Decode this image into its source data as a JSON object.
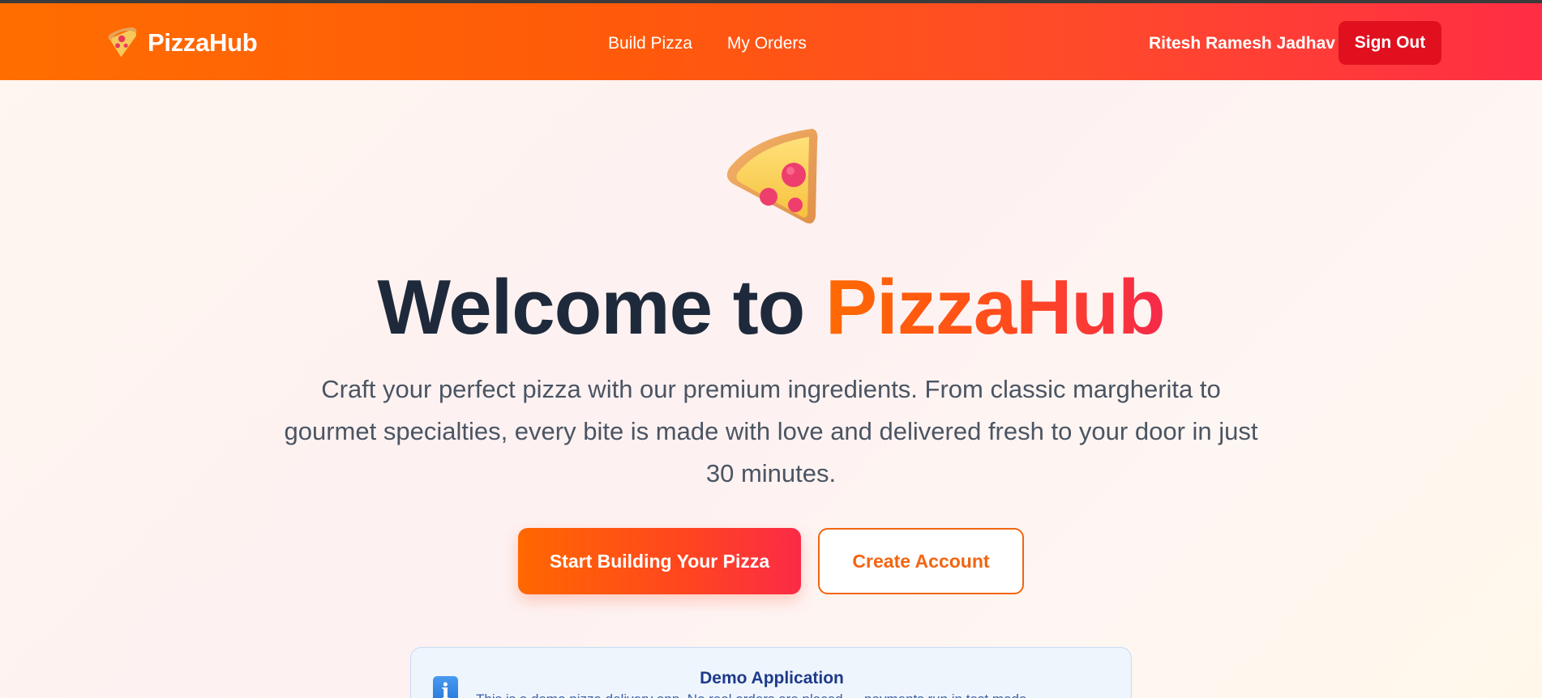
{
  "navbar": {
    "brand_name": "PizzaHub",
    "brand_icon": "pizza-slice-icon",
    "links": [
      "Build Pizza",
      "My Orders"
    ],
    "user_name": "Ritesh Ramesh Jadhav",
    "signout_label": "Sign Out"
  },
  "hero": {
    "icon": "pizza-slice-icon",
    "title_prefix": "Welcome to ",
    "title_brand_part1": "Pizza",
    "title_brand_part2": "Hub",
    "subtitle": "Craft your perfect pizza with our premium ingredients. From classic margherita to gourmet specialties, every bite is made with love and delivered fresh to your door in just 30 minutes.",
    "primary_button": "Start Building Your Pizza",
    "secondary_button": "Create Account"
  },
  "demo_notice": {
    "icon": "info-icon",
    "title": "Demo Application",
    "text": "This is a demo pizza delivery app. No real orders are placed — payments run in test mode."
  },
  "colors": {
    "navbar_start": "#ff6d00",
    "navbar_end": "#ff2d45",
    "signout_bg": "#e0101f",
    "accent_orange": "#f26511",
    "heading_dark": "#1e2a3b"
  }
}
